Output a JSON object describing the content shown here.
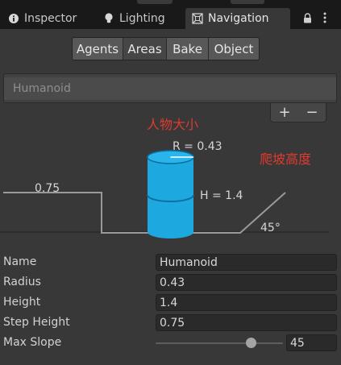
{
  "tabs": [
    {
      "label": "Inspector",
      "icon": "info-icon",
      "active": false
    },
    {
      "label": "Lighting",
      "icon": "bulb-icon",
      "active": false
    },
    {
      "label": "Navigation",
      "icon": "navigation-icon",
      "active": true
    }
  ],
  "toolbar": {
    "segments": [
      "Agents",
      "Areas",
      "Bake",
      "Object"
    ],
    "selected": "Areas"
  },
  "agent_list": {
    "items": [
      "Humanoid"
    ],
    "add_label": "+",
    "remove_label": "−"
  },
  "diagram": {
    "radius_label": "R = 0.43",
    "height_label": "H = 1.4",
    "step_label": "0.75",
    "slope_label": "45°",
    "annotation_size": "人物大小",
    "annotation_climb": "爬坡高度"
  },
  "properties": [
    {
      "label": "Name",
      "value": "Humanoid"
    },
    {
      "label": "Radius",
      "value": "0.43"
    },
    {
      "label": "Height",
      "value": "1.4"
    },
    {
      "label": "Step Height",
      "value": "0.75"
    }
  ],
  "max_slope": {
    "label": "Max Slope",
    "value": "45",
    "min": 0,
    "max": 60
  },
  "colors": {
    "accent_cyan": "#1ea8e0",
    "annotation_red": "#e03a2e",
    "panel_bg": "#383838"
  }
}
